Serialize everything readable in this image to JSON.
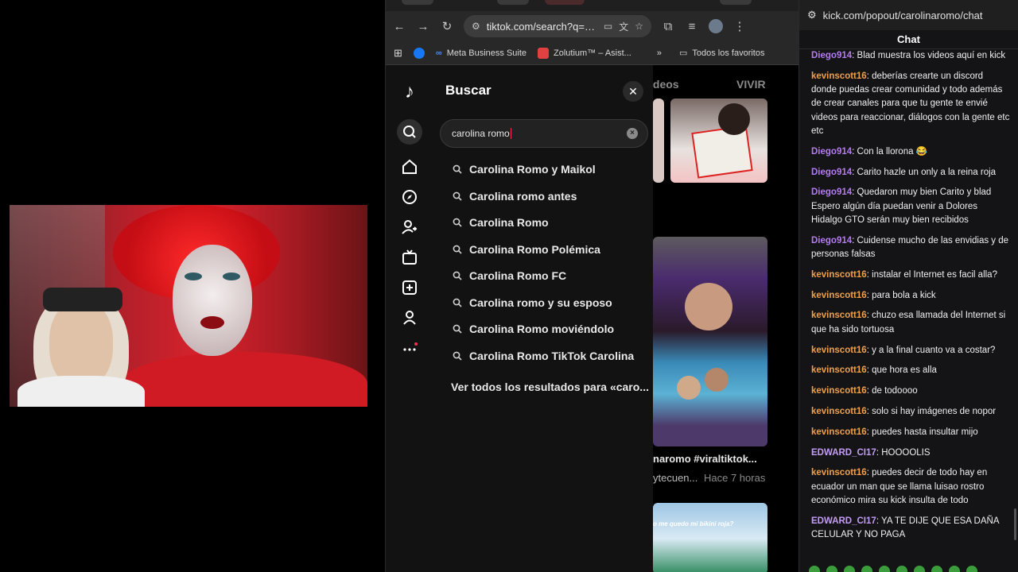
{
  "browser": {
    "url": "tiktok.com/search?q=c...",
    "bookmarks": [
      {
        "label": "Meta Business Suite",
        "icon": "meta-icon"
      },
      {
        "label": "Zolutium™ – Asist...",
        "icon": "zolutium-icon"
      }
    ],
    "all_favorites": "Todos los favoritos"
  },
  "tiktok": {
    "search_title": "Buscar",
    "search_value": "carolina romo",
    "suggestions": [
      "Carolina Romo y Maikol",
      "Carolina romo antes",
      "Carolina Romo",
      "Carolina Romo Polémica",
      "Carolina Romo FC",
      "Carolina romo y su esposo",
      "Carolina Romo moviéndolo",
      "Carolina Romo TikTok Carolina"
    ],
    "see_all": "Ver todos los resultados para «caro...",
    "result_tabs": [
      "ideos",
      "VIVIR"
    ],
    "result_caption": "naromo #viraltiktok...",
    "result_meta": "ytecuen...",
    "result_time": "Hace 7 horas",
    "thumb_caption": "o me quedo mi bikini roja?"
  },
  "chat": {
    "url": "kick.com/popout/carolinaromo/chat",
    "title": "Chat",
    "colors": {
      "Diego914": "#b27cf2",
      "kevinscott16": "#f0a04b",
      "EDWARD_CI17": "#c39cf5"
    },
    "messages": [
      {
        "user": "Diego914",
        "text": "Blad muestra los videos aquí en kick"
      },
      {
        "user": "kevinscott16",
        "text": "deberías crearte un discord donde puedas crear comunidad y todo además de crear canales para que tu gente te envié videos para reaccionar, diálogos con la gente etc etc"
      },
      {
        "user": "Diego914",
        "text": "Con la llorona 😂"
      },
      {
        "user": "Diego914",
        "text": "Carito hazle un only a la reina roja"
      },
      {
        "user": "Diego914",
        "text": "Quedaron muy bien Carito y blad Espero algún día puedan venir a Dolores Hidalgo GTO serán muy bien recibidos"
      },
      {
        "user": "Diego914",
        "text": "Cuidense mucho de las envidias y de personas falsas"
      },
      {
        "user": "kevinscott16",
        "text": "instalar el Internet es facil alla?"
      },
      {
        "user": "kevinscott16",
        "text": "para bola a kick"
      },
      {
        "user": "kevinscott16",
        "text": "chuzo esa llamada del Internet si que ha sido tortuosa"
      },
      {
        "user": "kevinscott16",
        "text": "y a la final cuanto va a costar?"
      },
      {
        "user": "kevinscott16",
        "text": "que hora es alla"
      },
      {
        "user": "kevinscott16",
        "text": "de todoooo"
      },
      {
        "user": "kevinscott16",
        "text": "solo si hay imágenes de nopor"
      },
      {
        "user": "kevinscott16",
        "text": "puedes hasta insultar mijo"
      },
      {
        "user": "EDWARD_CI17",
        "text": "HOOOOLIS"
      },
      {
        "user": "kevinscott16",
        "text": "puedes decir de todo hay en ecuador un man que se llama luisao rostro económico mira su kick insulta de todo"
      },
      {
        "user": "EDWARD_CI17",
        "text": "YA TE DIJE QUE ESA DAÑA CELULAR Y NO PAGA"
      }
    ]
  }
}
